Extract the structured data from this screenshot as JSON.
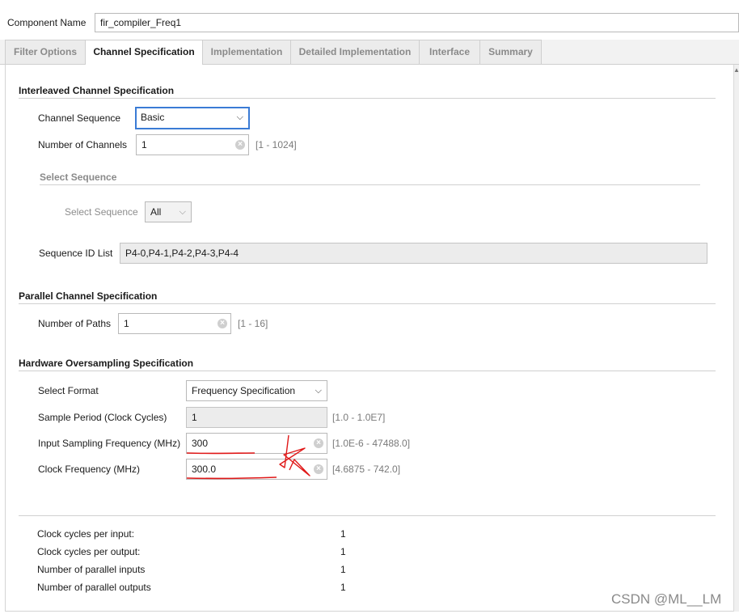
{
  "component": {
    "label": "Component Name",
    "value": "fir_compiler_Freq1"
  },
  "tabs": [
    {
      "label": "Filter Options"
    },
    {
      "label": "Channel Specification"
    },
    {
      "label": "Implementation"
    },
    {
      "label": "Detailed Implementation"
    },
    {
      "label": "Interface"
    },
    {
      "label": "Summary"
    }
  ],
  "interleaved": {
    "title": "Interleaved Channel Specification",
    "channel_sequence": {
      "label": "Channel Sequence",
      "value": "Basic"
    },
    "num_channels": {
      "label": "Number of Channels",
      "value": "1",
      "range": "[1 - 1024]"
    },
    "select_sequence_title": "Select Sequence",
    "select_sequence": {
      "label": "Select Sequence",
      "value": "All"
    },
    "sequence_id_list": {
      "label": "Sequence ID List",
      "value": "P4-0,P4-1,P4-2,P4-3,P4-4"
    }
  },
  "parallel": {
    "title": "Parallel Channel Specification",
    "num_paths": {
      "label": "Number of Paths",
      "value": "1",
      "range": "[1 - 16]"
    }
  },
  "hardware": {
    "title": "Hardware Oversampling Specification",
    "select_format": {
      "label": "Select Format",
      "value": "Frequency Specification"
    },
    "sample_period": {
      "label": "Sample Period (Clock Cycles)",
      "value": "1",
      "range": "[1.0 - 1.0E7]"
    },
    "input_freq": {
      "label": "Input Sampling Frequency (MHz)",
      "value": "300",
      "range": "[1.0E-6 - 47488.0]"
    },
    "clock_freq": {
      "label": "Clock Frequency (MHz)",
      "value": "300.0",
      "range": "[4.6875 - 742.0]"
    }
  },
  "summary": [
    {
      "label": "Clock cycles per input:",
      "value": "1"
    },
    {
      "label": "Clock cycles per output:",
      "value": "1"
    },
    {
      "label": "Number of parallel inputs",
      "value": "1"
    },
    {
      "label": "Number of parallel outputs",
      "value": "1"
    }
  ],
  "watermark": "CSDN @ML__LM",
  "colors": {
    "annotation": "#e01818",
    "focus": "#3a7bd5"
  }
}
